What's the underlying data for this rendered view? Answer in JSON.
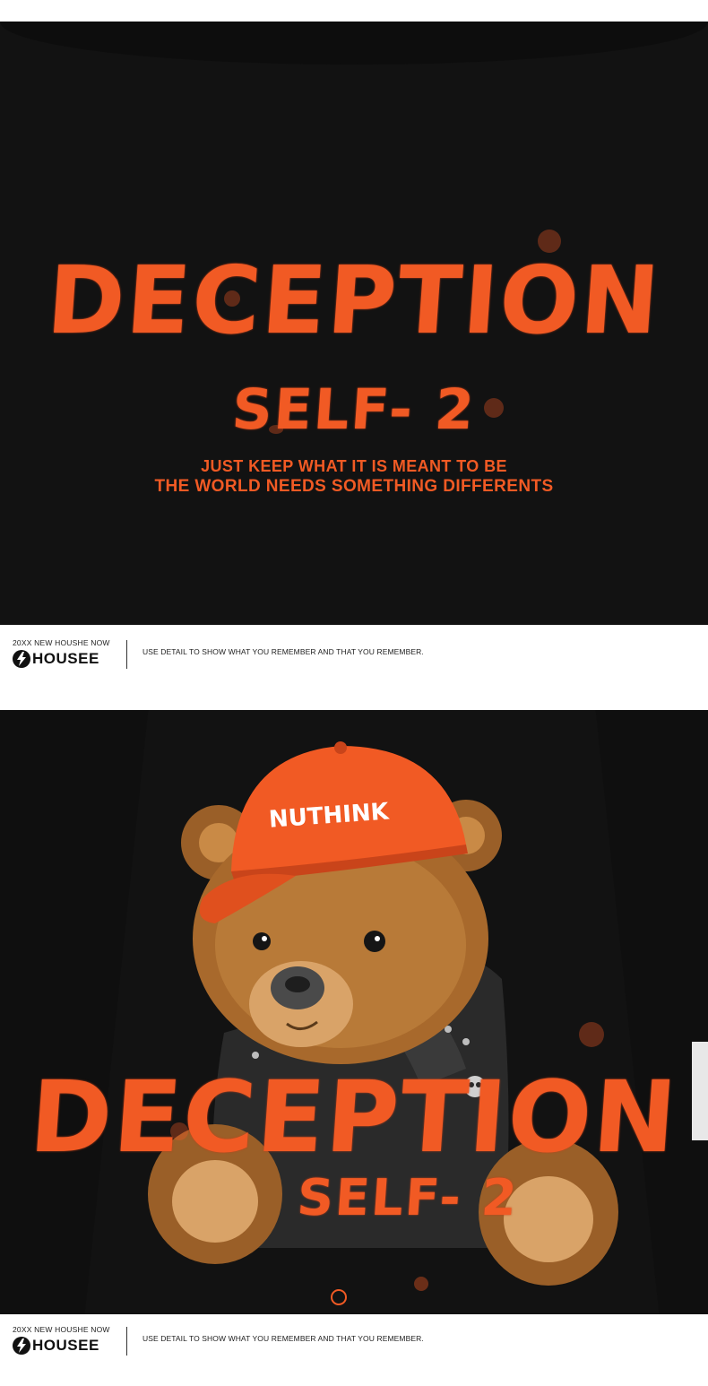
{
  "colors": {
    "shirt": "#121212",
    "print_orange": "#f15a24",
    "bear_fur": "#a8692c",
    "band": "#ffffff"
  },
  "panel1": {
    "title": "DECEPTION",
    "subtitle": "SELF- 2",
    "line1": "JUST KEEP WHAT IT IS MEANT TO BE",
    "line2": "THE WORLD NEEDS SOMETHING DIFFERENTS"
  },
  "info_band": {
    "small_text": "20XX NEW HOUSHE NOW",
    "brand": "HOUSEE",
    "brand_icon": "lightning-bolt-icon",
    "tagline": "USE DETAIL TO SHOW WHAT YOU REMEMBER AND THAT YOU REMEMBER."
  },
  "panel2": {
    "cap_text": "NUTHINK",
    "title": "DECEPTION",
    "subtitle": "SELF- 2",
    "emblem_icon": "hexagon-emblem-icon"
  }
}
